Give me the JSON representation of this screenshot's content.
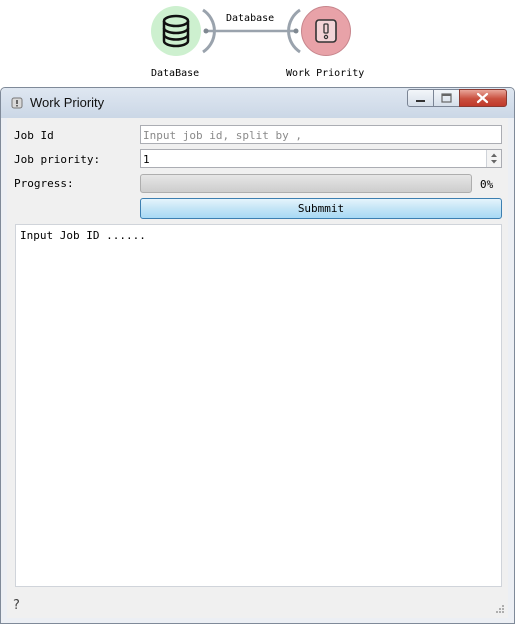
{
  "workflow": {
    "nodes": [
      {
        "label": "DataBase",
        "icon": "database-icon",
        "color": "#cdf0cf"
      },
      {
        "label": "Work Priority",
        "icon": "priority-icon",
        "color": "#e8a2a8"
      }
    ],
    "link_label": "Database"
  },
  "window": {
    "title": "Work Priority",
    "controls": [
      "minimize",
      "maximize",
      "close"
    ]
  },
  "form": {
    "job_id_label": "Job Id",
    "job_id_placeholder": "Input job id, split by ,",
    "job_id_value": "",
    "priority_label": "Job priority:",
    "priority_value": "1",
    "progress_label": "Progress:",
    "progress_value": 0,
    "progress_text": "0%",
    "submit_label": "Submmit"
  },
  "log": {
    "text": "Input Job ID ......"
  },
  "footer": {
    "help_icon": "?"
  }
}
